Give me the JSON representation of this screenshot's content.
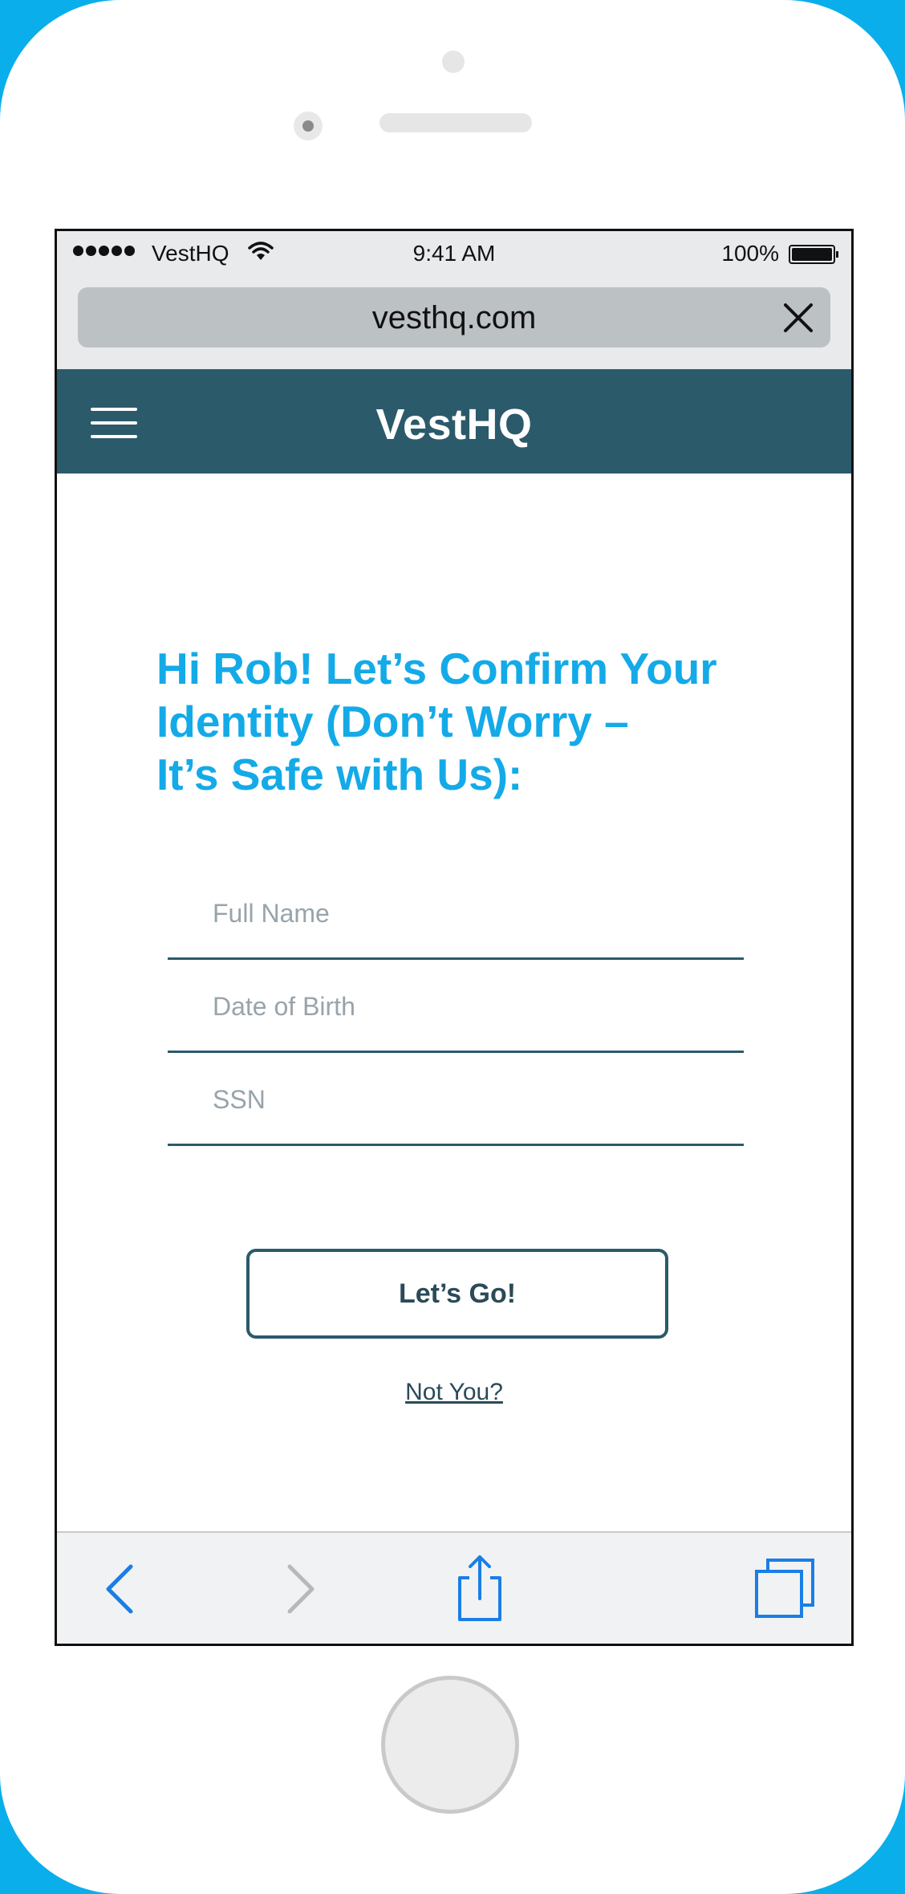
{
  "status_bar": {
    "carrier": "VestHQ",
    "time": "9:41 AM",
    "battery_percent": "100%",
    "battery_level": 1.0
  },
  "browser": {
    "url": "vesthq.com"
  },
  "app_header": {
    "logo": "VestHQ"
  },
  "main": {
    "heading": "Hi Rob! Let’s Confirm Your\nIdentity (Don’t Worry –\nIt’s Safe with Us):",
    "fields": {
      "full_name_placeholder": "Full Name",
      "dob_placeholder": "Date of Birth",
      "ssn_placeholder": "SSN"
    },
    "submit_label": "Let’s Go!",
    "not_you_link": "Not You?"
  },
  "colors": {
    "accent": "#14aae8",
    "header": "#2b5a6b",
    "frame_background": "#0aaeeb",
    "toolbar_icon": "#1a7ee6",
    "toolbar_icon_disabled": "#b5b9bc"
  },
  "icons": {
    "wifi": "wifi-icon",
    "battery": "battery-icon",
    "close": "close-icon",
    "menu": "hamburger-menu-icon",
    "back": "chevron-left-icon",
    "forward": "chevron-right-icon",
    "share": "share-icon",
    "tabs": "tabs-icon"
  }
}
